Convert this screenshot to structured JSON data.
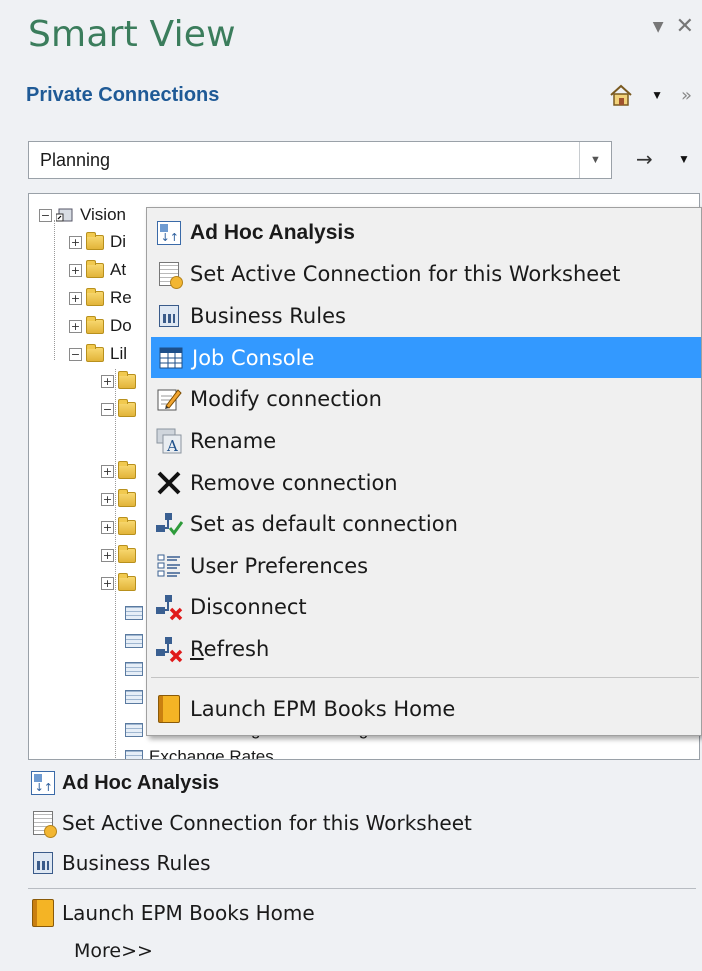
{
  "panel": {
    "title": "Smart View",
    "subtitle": "Private Connections",
    "pane_menu_glyph": "▼",
    "close_glyph": "✕",
    "more_glyph": "»"
  },
  "connection": {
    "selected": "Planning",
    "dropdown_glyph": "▼",
    "go_glyph": "→",
    "menu_glyph": "▼"
  },
  "tree": {
    "root_label": "Vision",
    "children": [
      "Di",
      "At",
      "Re",
      "Do",
      "Lil"
    ],
    "partial_items": [
      "Enter Exchange Rates - Single Period",
      "Exchange Rates"
    ]
  },
  "context_menu": {
    "items": [
      {
        "label": "Ad Hoc Analysis",
        "icon": "ad-hoc-icon"
      },
      {
        "label": "Set Active Connection for this Worksheet",
        "icon": "worksheet-connection-icon"
      },
      {
        "label": "Business Rules",
        "icon": "calculator-icon"
      },
      {
        "label": "Job Console",
        "icon": "job-console-icon"
      },
      {
        "label": "Modify connection",
        "icon": "edit-icon"
      },
      {
        "label": "Rename",
        "icon": "rename-icon"
      },
      {
        "label": "Remove connection",
        "icon": "remove-icon"
      },
      {
        "label": "Set as default connection",
        "icon": "default-connection-icon"
      },
      {
        "label": "User Preferences",
        "icon": "preferences-icon"
      },
      {
        "label": "Disconnect",
        "icon": "disconnect-icon"
      },
      {
        "label": "Refresh",
        "icon": "refresh-icon"
      },
      {
        "label": "Launch EPM Books Home",
        "icon": "book-icon"
      }
    ],
    "highlighted": "Job Console",
    "highlight_color": "#3399ff"
  },
  "actions": {
    "items": [
      "Ad Hoc Analysis",
      "Set Active Connection for this Worksheet",
      "Business Rules",
      "Launch EPM Books Home"
    ],
    "more": "More>>"
  },
  "colors": {
    "title": "#3b7d5c",
    "subtitle": "#1f5a96",
    "menu_highlight": "#3399ff"
  }
}
